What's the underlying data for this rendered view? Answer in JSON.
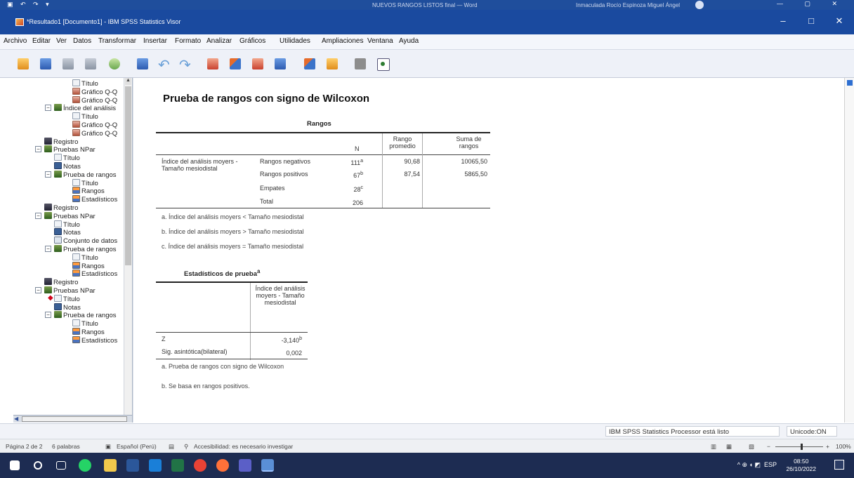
{
  "word_strip": {
    "doc_title": "NUEVOS RANGOS LISTOS final — Word",
    "user": "Inmaculada Rocío Espinoza Miguel Ángel",
    "ctrl_glyphs": "— ▢ ✕"
  },
  "window": {
    "title": "*Resultado1 [Documento1] - IBM SPSS Statistics Visor",
    "controls": {
      "minimize": "–",
      "maximize": "□",
      "close": "✕"
    }
  },
  "menu": [
    "Archivo",
    "Editar",
    "Ver",
    "Datos",
    "Transformar",
    "Insertar",
    "Formato",
    "Analizar",
    "Gráficos",
    "Utilidades",
    "Ampliaciones",
    "Ventana",
    "Ayuda"
  ],
  "toolbar_icons": [
    "open-icon",
    "save-icon",
    "print-icon",
    "print-preview-icon",
    "export-icon",
    "recall-dialog-icon",
    "undo-icon",
    "redo-icon",
    "goto-data-icon",
    "goto-case-icon",
    "goto-variable-icon",
    "variables-icon",
    "show-all-icon",
    "insert-output-icon",
    "hide-icon",
    "status-icon"
  ],
  "outline": [
    {
      "label": "Título",
      "icon": "title",
      "indent": 3
    },
    {
      "label": "Gráfico Q-Q",
      "icon": "chart",
      "indent": 3
    },
    {
      "label": "Gráfico Q-Q",
      "icon": "chart",
      "indent": 3
    },
    {
      "label": "Índice del análisis",
      "icon": "book",
      "indent": 2,
      "expander": "−"
    },
    {
      "label": "Título",
      "icon": "title",
      "indent": 3
    },
    {
      "label": "Gráfico Q-Q",
      "icon": "chart",
      "indent": 3
    },
    {
      "label": "Gráfico Q-Q",
      "icon": "chart",
      "indent": 3
    },
    {
      "label": "Registro",
      "icon": "log",
      "indent": 1
    },
    {
      "label": "Pruebas NPar",
      "icon": "book",
      "indent": 1,
      "expander": "−"
    },
    {
      "label": "Título",
      "icon": "title",
      "indent": 2
    },
    {
      "label": "Notas",
      "icon": "notes",
      "indent": 2
    },
    {
      "label": "Prueba de rangos",
      "icon": "book",
      "indent": 2,
      "expander": "−"
    },
    {
      "label": "Título",
      "icon": "title",
      "indent": 3
    },
    {
      "label": "Rangos",
      "icon": "table",
      "indent": 3
    },
    {
      "label": "Estadísticos",
      "icon": "table",
      "indent": 3
    },
    {
      "label": "Registro",
      "icon": "log",
      "indent": 1
    },
    {
      "label": "Pruebas NPar",
      "icon": "book",
      "indent": 1,
      "expander": "−"
    },
    {
      "label": "Título",
      "icon": "title",
      "indent": 2
    },
    {
      "label": "Notas",
      "icon": "notes",
      "indent": 2
    },
    {
      "label": "Conjunto de datos",
      "icon": "dataset",
      "indent": 2
    },
    {
      "label": "Prueba de rangos",
      "icon": "book",
      "indent": 2,
      "expander": "−"
    },
    {
      "label": "Título",
      "icon": "title",
      "indent": 3
    },
    {
      "label": "Rangos",
      "icon": "table",
      "indent": 3
    },
    {
      "label": "Estadísticos",
      "icon": "table",
      "indent": 3
    },
    {
      "label": "Registro",
      "icon": "log",
      "indent": 1
    },
    {
      "label": "Pruebas NPar",
      "icon": "book",
      "indent": 1,
      "expander": "−"
    },
    {
      "label": "Título",
      "icon": "title",
      "indent": 2,
      "marker": "◆"
    },
    {
      "label": "Notas",
      "icon": "notes",
      "indent": 2
    },
    {
      "label": "Prueba de rangos",
      "icon": "book",
      "indent": 2,
      "expander": "−"
    },
    {
      "label": "Título",
      "icon": "title",
      "indent": 3
    },
    {
      "label": "Rangos",
      "icon": "table",
      "indent": 3
    },
    {
      "label": "Estadísticos",
      "icon": "table",
      "indent": 3
    }
  ],
  "output": {
    "heading": "Prueba de rangos con signo de Wilcoxon",
    "ranks_table": {
      "title": "Rangos",
      "col_n": "N",
      "col_mean": "Rango promedio",
      "col_sum": "Suma de rangos",
      "var_label": "Índice del análisis moyers - Tamaño mesiodistal",
      "rows": [
        {
          "label": "Rangos negativos",
          "n": "111",
          "sup": "a",
          "mean": "90,68",
          "sum": "10065,50"
        },
        {
          "label": "Rangos positivos",
          "n": "67",
          "sup": "b",
          "mean": "87,54",
          "sum": "5865,50"
        },
        {
          "label": "Empates",
          "n": "28",
          "sup": "c",
          "mean": "",
          "sum": ""
        },
        {
          "label": "Total",
          "n": "206",
          "sup": "",
          "mean": "",
          "sum": ""
        }
      ],
      "footnotes": [
        "a. Índice del análisis moyers < Tamaño mesiodistal",
        "b. Índice del análisis moyers > Tamaño mesiodistal",
        "c. Índice del análisis moyers = Tamaño mesiodistal"
      ]
    },
    "test_table": {
      "title": "Estadísticos de prueba",
      "title_sup": "a",
      "col_header": "Índice del análisis moyers - Tamaño mesiodistal",
      "rows": [
        {
          "label": "Z",
          "value": "-3,140",
          "sup": "b"
        },
        {
          "label": "Sig. asintótica(bilateral)",
          "value": "0,002",
          "sup": ""
        }
      ],
      "footnotes": [
        "a. Prueba de rangos con signo de Wilcoxon",
        "b. Se basa en rangos positivos."
      ]
    }
  },
  "status": {
    "processor": "IBM SPSS Statistics Processor está listo",
    "unicode": "Unicode:ON"
  },
  "word_status": {
    "page": "Página 2 de 2",
    "words": "6 palabras",
    "language": "Español (Perú)",
    "accessibility": "Accesibilidad: es necesario investigar",
    "zoom": "100%",
    "zoom_minus": "−",
    "zoom_plus": "+"
  },
  "taskbar": {
    "time": "08:50",
    "date": "26/10/2022",
    "lang": "ESP",
    "tray": "^ ⊕ ◖ ◩"
  }
}
